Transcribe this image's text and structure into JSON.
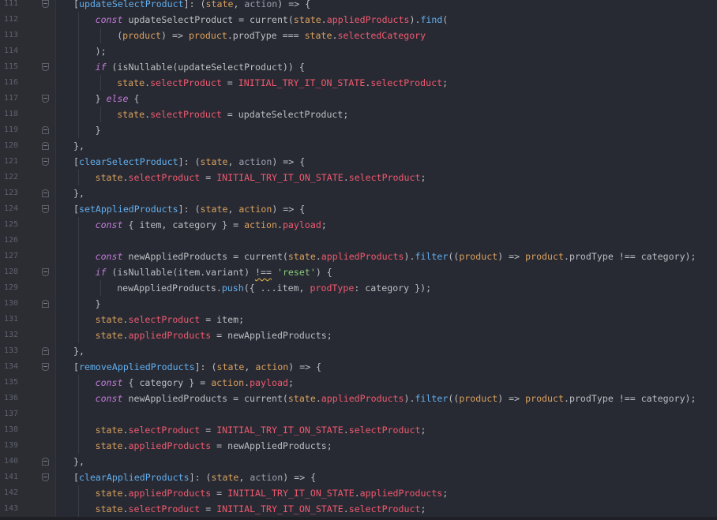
{
  "editor": {
    "lines": [
      {
        "n": "111",
        "fold": "open",
        "indent": 1,
        "tokens": [
          [
            "p",
            "["
          ],
          [
            "fn",
            "updateSelectProduct"
          ],
          [
            "p",
            "]: ("
          ],
          [
            "param",
            "state"
          ],
          [
            "p",
            ", "
          ],
          [
            "arg",
            "action"
          ],
          [
            "p",
            ") => {"
          ]
        ]
      },
      {
        "n": "112",
        "fold": "",
        "indent": 2,
        "tokens": [
          [
            "kw",
            "const"
          ],
          [
            "p",
            " updateSelectProduct = current("
          ],
          [
            "param",
            "state"
          ],
          [
            "p",
            "."
          ],
          [
            "prop",
            "appliedProducts"
          ],
          [
            "p",
            ")."
          ],
          [
            "fn",
            "find"
          ],
          [
            "p",
            "("
          ]
        ]
      },
      {
        "n": "113",
        "fold": "",
        "indent": 3,
        "tokens": [
          [
            "p",
            "("
          ],
          [
            "param",
            "product"
          ],
          [
            "p",
            ") => "
          ],
          [
            "param",
            "product"
          ],
          [
            "p",
            ".prodType === "
          ],
          [
            "param",
            "state"
          ],
          [
            "p",
            "."
          ],
          [
            "prop",
            "selectedCategory"
          ]
        ]
      },
      {
        "n": "114",
        "fold": "",
        "indent": 2,
        "tokens": [
          [
            "p",
            ");"
          ]
        ]
      },
      {
        "n": "115",
        "fold": "open",
        "indent": 2,
        "tokens": [
          [
            "kw",
            "if"
          ],
          [
            "p",
            " (isNullable(updateSelectProduct)) {"
          ]
        ]
      },
      {
        "n": "116",
        "fold": "",
        "indent": 3,
        "tokens": [
          [
            "param",
            "state"
          ],
          [
            "p",
            "."
          ],
          [
            "prop",
            "selectProduct"
          ],
          [
            "p",
            " = "
          ],
          [
            "const",
            "INITIAL_TRY_IT_ON_STATE"
          ],
          [
            "p",
            "."
          ],
          [
            "prop",
            "selectProduct"
          ],
          [
            "p",
            ";"
          ]
        ]
      },
      {
        "n": "117",
        "fold": "open",
        "indent": 2,
        "tokens": [
          [
            "p",
            "} "
          ],
          [
            "kw",
            "else"
          ],
          [
            "p",
            " {"
          ]
        ]
      },
      {
        "n": "118",
        "fold": "",
        "indent": 3,
        "tokens": [
          [
            "param",
            "state"
          ],
          [
            "p",
            "."
          ],
          [
            "prop",
            "selectProduct"
          ],
          [
            "p",
            " = updateSelectProduct;"
          ]
        ]
      },
      {
        "n": "119",
        "fold": "close",
        "indent": 2,
        "tokens": [
          [
            "p",
            "}"
          ]
        ]
      },
      {
        "n": "120",
        "fold": "close",
        "indent": 1,
        "tokens": [
          [
            "p",
            "},"
          ]
        ]
      },
      {
        "n": "121",
        "fold": "open",
        "indent": 1,
        "tokens": [
          [
            "p",
            "["
          ],
          [
            "fn",
            "clearSelectProduct"
          ],
          [
            "p",
            "]: ("
          ],
          [
            "param",
            "state"
          ],
          [
            "p",
            ", "
          ],
          [
            "arg",
            "action"
          ],
          [
            "p",
            ") => {"
          ]
        ]
      },
      {
        "n": "122",
        "fold": "",
        "indent": 2,
        "tokens": [
          [
            "param",
            "state"
          ],
          [
            "p",
            "."
          ],
          [
            "prop",
            "selectProduct"
          ],
          [
            "p",
            " = "
          ],
          [
            "const",
            "INITIAL_TRY_IT_ON_STATE"
          ],
          [
            "p",
            "."
          ],
          [
            "prop",
            "selectProduct"
          ],
          [
            "p",
            ";"
          ]
        ]
      },
      {
        "n": "123",
        "fold": "close",
        "indent": 1,
        "tokens": [
          [
            "p",
            "},"
          ]
        ]
      },
      {
        "n": "124",
        "fold": "open",
        "indent": 1,
        "tokens": [
          [
            "p",
            "["
          ],
          [
            "fn",
            "setAppliedProducts"
          ],
          [
            "p",
            "]: ("
          ],
          [
            "param",
            "state"
          ],
          [
            "p",
            ", "
          ],
          [
            "param",
            "action"
          ],
          [
            "p",
            ") => {"
          ]
        ]
      },
      {
        "n": "125",
        "fold": "",
        "indent": 2,
        "tokens": [
          [
            "kw",
            "const"
          ],
          [
            "p",
            " { item, category } = "
          ],
          [
            "param",
            "action"
          ],
          [
            "p",
            "."
          ],
          [
            "prop",
            "payload"
          ],
          [
            "p",
            ";"
          ]
        ]
      },
      {
        "n": "126",
        "fold": "",
        "indent": 2,
        "tokens": []
      },
      {
        "n": "127",
        "fold": "",
        "indent": 2,
        "tokens": [
          [
            "kw",
            "const"
          ],
          [
            "p",
            " newAppliedProducts = current("
          ],
          [
            "param",
            "state"
          ],
          [
            "p",
            "."
          ],
          [
            "prop",
            "appliedProducts"
          ],
          [
            "p",
            ")."
          ],
          [
            "fn",
            "filter"
          ],
          [
            "p",
            "(("
          ],
          [
            "param",
            "product"
          ],
          [
            "p",
            ") => "
          ],
          [
            "param",
            "product"
          ],
          [
            "p",
            ".prodType !== category);"
          ]
        ]
      },
      {
        "n": "128",
        "fold": "open",
        "indent": 2,
        "tokens": [
          [
            "kw",
            "if"
          ],
          [
            "p",
            " (isNullable(item.variant) "
          ],
          [
            "squig",
            "!=="
          ],
          [
            "p",
            " "
          ],
          [
            "str",
            "'reset'"
          ],
          [
            "p",
            ") {"
          ]
        ]
      },
      {
        "n": "129",
        "fold": "",
        "indent": 3,
        "tokens": [
          [
            "p",
            "newAppliedProducts."
          ],
          [
            "fn",
            "push"
          ],
          [
            "p",
            "({ ...item, "
          ],
          [
            "prop",
            "prodType"
          ],
          [
            "p",
            ": category });"
          ]
        ]
      },
      {
        "n": "130",
        "fold": "close",
        "indent": 2,
        "tokens": [
          [
            "p",
            "}"
          ]
        ]
      },
      {
        "n": "131",
        "fold": "",
        "indent": 2,
        "tokens": [
          [
            "param",
            "state"
          ],
          [
            "p",
            "."
          ],
          [
            "prop",
            "selectProduct"
          ],
          [
            "p",
            " = item;"
          ]
        ]
      },
      {
        "n": "132",
        "fold": "",
        "indent": 2,
        "tokens": [
          [
            "param",
            "state"
          ],
          [
            "p",
            "."
          ],
          [
            "prop",
            "appliedProducts"
          ],
          [
            "p",
            " = newAppliedProducts;"
          ]
        ]
      },
      {
        "n": "133",
        "fold": "close",
        "indent": 1,
        "tokens": [
          [
            "p",
            "},"
          ]
        ]
      },
      {
        "n": "134",
        "fold": "open",
        "indent": 1,
        "tokens": [
          [
            "p",
            "["
          ],
          [
            "fn",
            "removeAppliedProducts"
          ],
          [
            "p",
            "]: ("
          ],
          [
            "param",
            "state"
          ],
          [
            "p",
            ", "
          ],
          [
            "param",
            "action"
          ],
          [
            "p",
            ") => {"
          ]
        ]
      },
      {
        "n": "135",
        "fold": "",
        "indent": 2,
        "tokens": [
          [
            "kw",
            "const"
          ],
          [
            "p",
            " { category } = "
          ],
          [
            "param",
            "action"
          ],
          [
            "p",
            "."
          ],
          [
            "prop",
            "payload"
          ],
          [
            "p",
            ";"
          ]
        ]
      },
      {
        "n": "136",
        "fold": "",
        "indent": 2,
        "tokens": [
          [
            "kw",
            "const"
          ],
          [
            "p",
            " newAppliedProducts = current("
          ],
          [
            "param",
            "state"
          ],
          [
            "p",
            "."
          ],
          [
            "prop",
            "appliedProducts"
          ],
          [
            "p",
            ")."
          ],
          [
            "fn",
            "filter"
          ],
          [
            "p",
            "(("
          ],
          [
            "param",
            "product"
          ],
          [
            "p",
            ") => "
          ],
          [
            "param",
            "product"
          ],
          [
            "p",
            ".prodType !== category);"
          ]
        ]
      },
      {
        "n": "137",
        "fold": "",
        "indent": 2,
        "tokens": []
      },
      {
        "n": "138",
        "fold": "",
        "indent": 2,
        "tokens": [
          [
            "param",
            "state"
          ],
          [
            "p",
            "."
          ],
          [
            "prop",
            "selectProduct"
          ],
          [
            "p",
            " = "
          ],
          [
            "const",
            "INITIAL_TRY_IT_ON_STATE"
          ],
          [
            "p",
            "."
          ],
          [
            "prop",
            "selectProduct"
          ],
          [
            "p",
            ";"
          ]
        ]
      },
      {
        "n": "139",
        "fold": "",
        "indent": 2,
        "tokens": [
          [
            "param",
            "state"
          ],
          [
            "p",
            "."
          ],
          [
            "prop",
            "appliedProducts"
          ],
          [
            "p",
            " = newAppliedProducts;"
          ]
        ]
      },
      {
        "n": "140",
        "fold": "close",
        "indent": 1,
        "tokens": [
          [
            "p",
            "},"
          ]
        ]
      },
      {
        "n": "141",
        "fold": "open",
        "indent": 1,
        "tokens": [
          [
            "p",
            "["
          ],
          [
            "fn",
            "clearAppliedProducts"
          ],
          [
            "p",
            "]: ("
          ],
          [
            "param",
            "state"
          ],
          [
            "p",
            ", "
          ],
          [
            "arg",
            "action"
          ],
          [
            "p",
            ") => {"
          ]
        ]
      },
      {
        "n": "142",
        "fold": "",
        "indent": 2,
        "tokens": [
          [
            "param",
            "state"
          ],
          [
            "p",
            "."
          ],
          [
            "prop",
            "appliedProducts"
          ],
          [
            "p",
            " = "
          ],
          [
            "const",
            "INITIAL_TRY_IT_ON_STATE"
          ],
          [
            "p",
            "."
          ],
          [
            "prop",
            "appliedProducts"
          ],
          [
            "p",
            ";"
          ]
        ]
      },
      {
        "n": "143",
        "fold": "",
        "indent": 2,
        "tokens": [
          [
            "param",
            "state"
          ],
          [
            "p",
            "."
          ],
          [
            "prop",
            "selectProduct"
          ],
          [
            "p",
            " = "
          ],
          [
            "const",
            "INITIAL_TRY_IT_ON_STATE"
          ],
          [
            "p",
            "."
          ],
          [
            "prop",
            "selectProduct"
          ],
          [
            "p",
            ";"
          ]
        ]
      }
    ]
  },
  "colors": {
    "background": "#282a33",
    "keyword": "#c17bd8",
    "property": "#ef596f",
    "parameter": "#d8a05d",
    "function": "#61afef",
    "string": "#89ca78"
  }
}
